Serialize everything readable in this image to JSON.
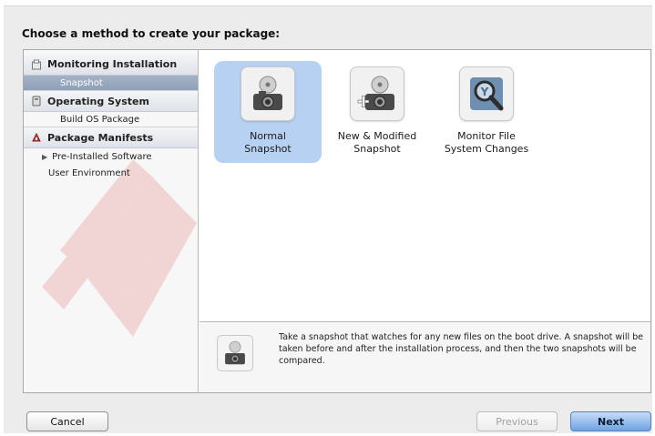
{
  "window": {
    "title": "Choose a method to create your package:"
  },
  "sidebar": {
    "sections": [
      {
        "label": "Monitoring Installation",
        "icon": "box-icon",
        "children": [
          {
            "label": "Snapshot",
            "selected": true
          }
        ]
      },
      {
        "label": "Operating System",
        "icon": "os-icon",
        "children": [
          {
            "label": "Build OS Package",
            "selected": false
          }
        ]
      },
      {
        "label": "Package Manifests",
        "icon": "manifest-icon",
        "children": [
          {
            "label": "Pre-Installed Software",
            "collapsed": true
          },
          {
            "label": "User Environment"
          }
        ]
      }
    ]
  },
  "options": [
    {
      "label": "Normal\nSnapshot",
      "icon": "camera-disk-icon",
      "selected": true
    },
    {
      "label": "New & Modified\nSnapshot",
      "icon": "camera-disk-plus-icon",
      "selected": false
    },
    {
      "label": "Monitor File\nSystem Changes",
      "icon": "magnifier-icon",
      "selected": false
    }
  ],
  "description": {
    "icon": "camera-disk-icon",
    "text": "Take a snapshot that watches for any new files on the boot drive. A snapshot will be taken before and after the installation process, and then the two snapshots will be compared."
  },
  "buttons": {
    "cancel": "Cancel",
    "previous": "Previous",
    "next": "Next"
  },
  "colors": {
    "selection": "#b7d1f3",
    "sidebar_selected": "#97a8be",
    "watermark": "#d42a2a",
    "next_button": "#6fa3e3"
  }
}
